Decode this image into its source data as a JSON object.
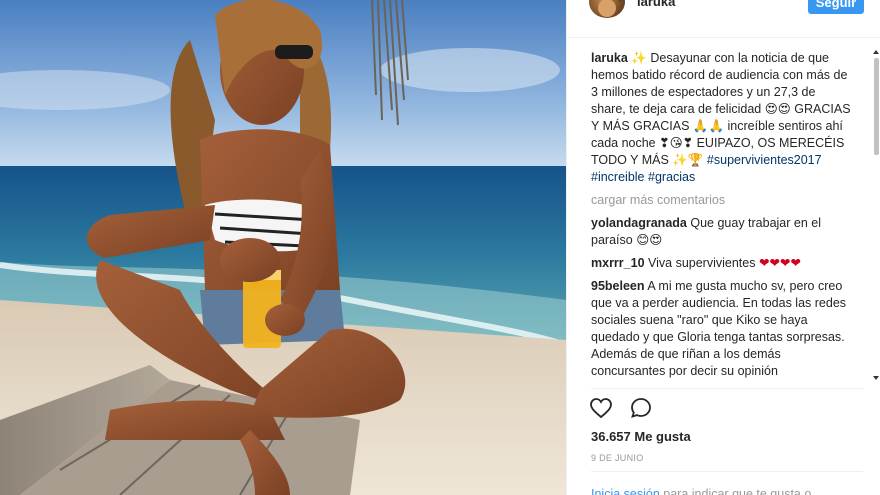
{
  "post": {
    "author": "laruka",
    "follow_label": "Seguir"
  },
  "caption": {
    "user": "laruka",
    "emoji_lead": "✨",
    "text_1": "Desayunar con la noticia de que hemos batido récord de audiencia con más de 3 millones de espectadores y un 27,3 de share, te deja cara de felicidad",
    "emoji_a": "😍😍",
    "text_2": "GRACIAS Y MÁS GRACIAS",
    "emoji_b": "🙏🙏",
    "text_3": "increíble sentiros ahí cada noche",
    "emoji_c": "❣😘❣",
    "text_4": "EUIPAZO, OS MERECÉIS TODO Y MÁS",
    "emoji_d": "✨🏆",
    "hashtags": [
      "#supervivientes2017",
      "#increible",
      "#gracias"
    ]
  },
  "load_more_label": "cargar más comentarios",
  "comments": [
    {
      "user": "yolandagranada",
      "text": "Que guay trabajar en el paraíso",
      "emoji": "😊😍"
    },
    {
      "user": "mxrrr_10",
      "text": "Viva supervivientes",
      "emoji": "❤❤❤❤"
    },
    {
      "user": "95beleen",
      "text": "A mi me gusta mucho sv, pero creo que va a perder audiencia. En todas las redes sociales suena \"raro\" que Kiko se haya quedado y que Gloria tenga tantas sorpresas. Además de que riñan a los demás concursantes por decir su opinión",
      "emoji": ""
    }
  ],
  "likes_label": "36.657 Me gusta",
  "date_label": "9 DE JUNIO",
  "footer": {
    "login_link": "Inicia sesión",
    "rest": "para indicar que te gusta o"
  },
  "icons": [
    "heart-icon",
    "comment-icon"
  ],
  "colors": {
    "follow_button": "#3897f0",
    "hashtag": "#003569",
    "muted": "#999999"
  }
}
